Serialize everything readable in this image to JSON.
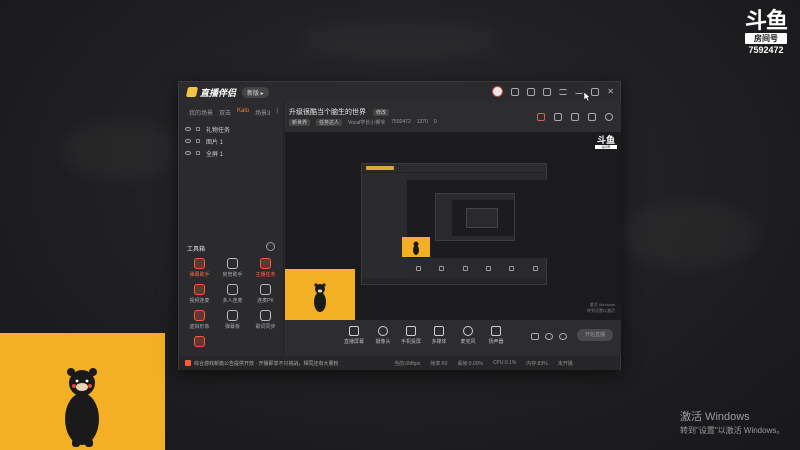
{
  "douyu": {
    "logo_glyph": "斗鱼",
    "tag": "房间号",
    "room_number": "7592472"
  },
  "windows_activation": {
    "line1": "激活 Windows",
    "line2": "转到\"设置\"以激活 Windows。"
  },
  "app": {
    "name": "直播伴侣",
    "version_pill": "新版 ▸",
    "titlebar_icons": [
      "avatar-icon",
      "message-icon",
      "skin-icon",
      "gift-icon",
      "menu-icon",
      "minimize-icon",
      "maximize-icon",
      "close-icon"
    ]
  },
  "left_panel": {
    "scene_tabs": [
      {
        "label": "我的场景",
        "active": false
      },
      {
        "label": "双击",
        "active": false
      },
      {
        "label": "Kalo",
        "active": true
      },
      {
        "label": "场景3",
        "active": false
      },
      {
        "label": "|",
        "active": false
      }
    ],
    "sources": [
      {
        "label": "礼物任务"
      },
      {
        "label": "图片 1"
      },
      {
        "label": "全屏 1"
      }
    ],
    "tools_title": "工具箱",
    "tools_more": "···",
    "tools": [
      {
        "label": "弹幕助手",
        "hot": true
      },
      {
        "label": "房管助手",
        "hot": false
      },
      {
        "label": "主播任务",
        "hot": true
      },
      {
        "label": "视频连麦",
        "hot": false
      },
      {
        "label": "多人连麦",
        "hot": false
      },
      {
        "label": "连麦PK",
        "hot": false
      },
      {
        "label": "虚拟形象",
        "hot": false
      },
      {
        "label": "弹幕板",
        "hot": false
      },
      {
        "label": "歌词同步",
        "hot": false
      },
      {
        "label": "",
        "hot": true
      }
    ]
  },
  "header": {
    "room_title": "升级很酷当个脑生的世界",
    "edit_label": "修改",
    "category": "新世界",
    "tag": "任务达人",
    "anchor_name": "Vocal学长小狮爷",
    "room_id": "7592472",
    "heat": "1370",
    "followers": "0"
  },
  "preview": {
    "mini_logo": "斗鱼",
    "mini_tag": "房间号",
    "win_line1": "激活 Windows",
    "win_line2": "转到设置以激活"
  },
  "controls": [
    {
      "label": "直播屏幕"
    },
    {
      "label": "摄像头"
    },
    {
      "label": "手机投屏"
    },
    {
      "label": "多媒体"
    },
    {
      "label": "麦克风"
    },
    {
      "label": "扬声器"
    }
  ],
  "live_button": "开始直播",
  "status_bar": {
    "announcement": "综合游戏新篇公告提供开放 · 开播即享不只挑战，相同还有大量粉",
    "stats": [
      "当前:0Mbps",
      "帧率:60",
      "丢帧:0.00%",
      "CPU:9.1%",
      "内存:83%",
      "未开播"
    ]
  }
}
